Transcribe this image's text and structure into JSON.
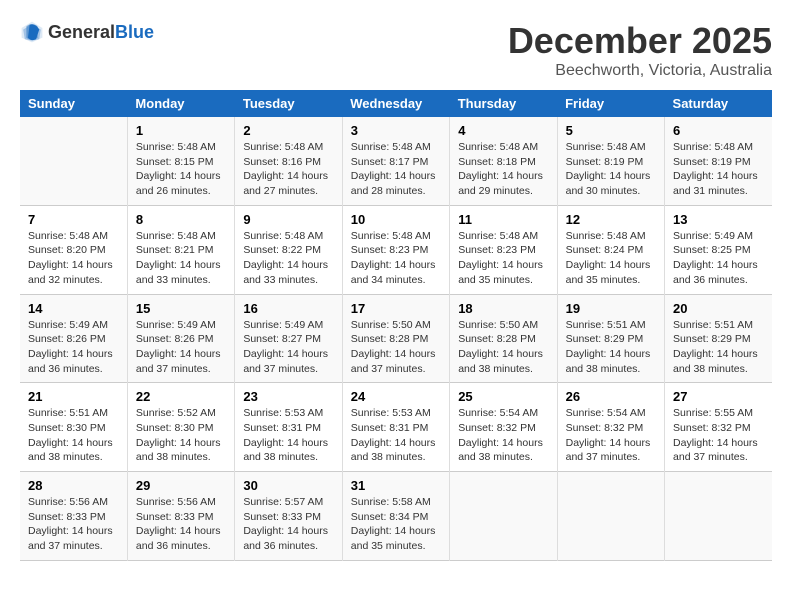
{
  "header": {
    "logo": {
      "general": "General",
      "blue": "Blue"
    },
    "title": "December 2025",
    "subtitle": "Beechworth, Victoria, Australia"
  },
  "calendar": {
    "weekdays": [
      "Sunday",
      "Monday",
      "Tuesday",
      "Wednesday",
      "Thursday",
      "Friday",
      "Saturday"
    ],
    "weeks": [
      [
        {
          "date": "",
          "info": ""
        },
        {
          "date": "1",
          "info": "Sunrise: 5:48 AM\nSunset: 8:15 PM\nDaylight: 14 hours\nand 26 minutes."
        },
        {
          "date": "2",
          "info": "Sunrise: 5:48 AM\nSunset: 8:16 PM\nDaylight: 14 hours\nand 27 minutes."
        },
        {
          "date": "3",
          "info": "Sunrise: 5:48 AM\nSunset: 8:17 PM\nDaylight: 14 hours\nand 28 minutes."
        },
        {
          "date": "4",
          "info": "Sunrise: 5:48 AM\nSunset: 8:18 PM\nDaylight: 14 hours\nand 29 minutes."
        },
        {
          "date": "5",
          "info": "Sunrise: 5:48 AM\nSunset: 8:19 PM\nDaylight: 14 hours\nand 30 minutes."
        },
        {
          "date": "6",
          "info": "Sunrise: 5:48 AM\nSunset: 8:19 PM\nDaylight: 14 hours\nand 31 minutes."
        }
      ],
      [
        {
          "date": "7",
          "info": "Sunrise: 5:48 AM\nSunset: 8:20 PM\nDaylight: 14 hours\nand 32 minutes."
        },
        {
          "date": "8",
          "info": "Sunrise: 5:48 AM\nSunset: 8:21 PM\nDaylight: 14 hours\nand 33 minutes."
        },
        {
          "date": "9",
          "info": "Sunrise: 5:48 AM\nSunset: 8:22 PM\nDaylight: 14 hours\nand 33 minutes."
        },
        {
          "date": "10",
          "info": "Sunrise: 5:48 AM\nSunset: 8:23 PM\nDaylight: 14 hours\nand 34 minutes."
        },
        {
          "date": "11",
          "info": "Sunrise: 5:48 AM\nSunset: 8:23 PM\nDaylight: 14 hours\nand 35 minutes."
        },
        {
          "date": "12",
          "info": "Sunrise: 5:48 AM\nSunset: 8:24 PM\nDaylight: 14 hours\nand 35 minutes."
        },
        {
          "date": "13",
          "info": "Sunrise: 5:49 AM\nSunset: 8:25 PM\nDaylight: 14 hours\nand 36 minutes."
        }
      ],
      [
        {
          "date": "14",
          "info": "Sunrise: 5:49 AM\nSunset: 8:26 PM\nDaylight: 14 hours\nand 36 minutes."
        },
        {
          "date": "15",
          "info": "Sunrise: 5:49 AM\nSunset: 8:26 PM\nDaylight: 14 hours\nand 37 minutes."
        },
        {
          "date": "16",
          "info": "Sunrise: 5:49 AM\nSunset: 8:27 PM\nDaylight: 14 hours\nand 37 minutes."
        },
        {
          "date": "17",
          "info": "Sunrise: 5:50 AM\nSunset: 8:28 PM\nDaylight: 14 hours\nand 37 minutes."
        },
        {
          "date": "18",
          "info": "Sunrise: 5:50 AM\nSunset: 8:28 PM\nDaylight: 14 hours\nand 38 minutes."
        },
        {
          "date": "19",
          "info": "Sunrise: 5:51 AM\nSunset: 8:29 PM\nDaylight: 14 hours\nand 38 minutes."
        },
        {
          "date": "20",
          "info": "Sunrise: 5:51 AM\nSunset: 8:29 PM\nDaylight: 14 hours\nand 38 minutes."
        }
      ],
      [
        {
          "date": "21",
          "info": "Sunrise: 5:51 AM\nSunset: 8:30 PM\nDaylight: 14 hours\nand 38 minutes."
        },
        {
          "date": "22",
          "info": "Sunrise: 5:52 AM\nSunset: 8:30 PM\nDaylight: 14 hours\nand 38 minutes."
        },
        {
          "date": "23",
          "info": "Sunrise: 5:53 AM\nSunset: 8:31 PM\nDaylight: 14 hours\nand 38 minutes."
        },
        {
          "date": "24",
          "info": "Sunrise: 5:53 AM\nSunset: 8:31 PM\nDaylight: 14 hours\nand 38 minutes."
        },
        {
          "date": "25",
          "info": "Sunrise: 5:54 AM\nSunset: 8:32 PM\nDaylight: 14 hours\nand 38 minutes."
        },
        {
          "date": "26",
          "info": "Sunrise: 5:54 AM\nSunset: 8:32 PM\nDaylight: 14 hours\nand 37 minutes."
        },
        {
          "date": "27",
          "info": "Sunrise: 5:55 AM\nSunset: 8:32 PM\nDaylight: 14 hours\nand 37 minutes."
        }
      ],
      [
        {
          "date": "28",
          "info": "Sunrise: 5:56 AM\nSunset: 8:33 PM\nDaylight: 14 hours\nand 37 minutes."
        },
        {
          "date": "29",
          "info": "Sunrise: 5:56 AM\nSunset: 8:33 PM\nDaylight: 14 hours\nand 36 minutes."
        },
        {
          "date": "30",
          "info": "Sunrise: 5:57 AM\nSunset: 8:33 PM\nDaylight: 14 hours\nand 36 minutes."
        },
        {
          "date": "31",
          "info": "Sunrise: 5:58 AM\nSunset: 8:34 PM\nDaylight: 14 hours\nand 35 minutes."
        },
        {
          "date": "",
          "info": ""
        },
        {
          "date": "",
          "info": ""
        },
        {
          "date": "",
          "info": ""
        }
      ]
    ]
  }
}
